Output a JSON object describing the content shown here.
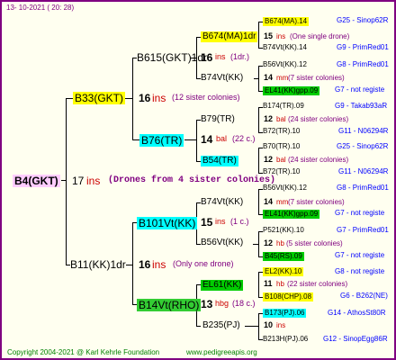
{
  "header": {
    "date": "13- 10-2021 ( 20: 28)"
  },
  "footer": {
    "copyright": "Copyright 2004-2021 @ Karl Kehrle Foundation",
    "website": "www.pedigreeapis.org"
  },
  "root": {
    "name": "B4(GKT)",
    "count": "17",
    "ins": "ins",
    "note": "(Drones from 4 sister colonies)"
  },
  "gen2": [
    {
      "name": "B33(GKT)",
      "count": "16",
      "ins": "ins",
      "note": "(12 sister colonies)"
    },
    {
      "name": "B11(KK)1dr",
      "count": "16",
      "ins": "ins",
      "note": "(Only one drone)"
    }
  ],
  "gen3": [
    {
      "name": "B615(GKT)1dr",
      "count": "16",
      "ins": "ins",
      "note": "(1dr.)"
    },
    {
      "name": "B76(TR)",
      "count": "14",
      "ins": "bal",
      "note": "(22 c.)"
    },
    {
      "name": "B101Vt(KK)",
      "count": "15",
      "ins": "ins",
      "note": "(1 c.)"
    },
    {
      "name": "B14Vt(RHO)",
      "count": "13",
      "ins": "hbg",
      "note": "(18 c.)"
    }
  ],
  "gen4": [
    {
      "name": "B674(MA)1dr",
      "count": "15",
      "ins": "ins",
      "note": "(One single drone)"
    },
    {
      "name": "B74Vt(KK)"
    },
    {
      "name": "B79(TR)",
      "count": "12",
      "ins": "bal",
      "note": "(24 sister colonies)"
    },
    {
      "name": "B54(TR)",
      "count": "12",
      "ins": "bal",
      "note": "(24 sister colonies)"
    },
    {
      "name": "B74Vt(KK)",
      "count": "14",
      "ins": "mm",
      "note": "(7 sister colonies)"
    },
    {
      "name": "B56Vt(KK)"
    },
    {
      "name": "EL61(KK)",
      "count": "11",
      "ins": "hb",
      "note": "(22 sister colonies)"
    },
    {
      "name": "B235(PJ)",
      "count": "10",
      "ins": "ins",
      "note": ""
    }
  ],
  "gen5": [
    {
      "name": "B674(MA).14",
      "code": "G25 - Sinop62R"
    },
    {
      "name": "B74Vt(KK).14",
      "code": "G9 - PrimRed01"
    },
    {
      "name": "B56Vt(KK).12",
      "code": "G8 - PrimRed01"
    },
    {
      "name": "EL41(KK)gpp.09",
      "code": "G7 - not registe"
    },
    {
      "name": "B174(TR).09",
      "code": "G9 - Takab93aR"
    },
    {
      "name": "B72(TR).10",
      "code": "G11 - N06294R"
    },
    {
      "name": "B70(TR).10",
      "code": "G25 - Sinop62R"
    },
    {
      "name": "B72(TR).10",
      "code": "G11 - N06294R"
    },
    {
      "name": "B56Vt(KK).12",
      "code": "G8 - PrimRed01"
    },
    {
      "name": "EL41(KK)gpp.09",
      "code": "G7 - not registe"
    },
    {
      "name": "P521(KK).10",
      "code": "G7 - PrimRed01"
    },
    {
      "name": "B45(RS).09",
      "code": "G7 - not registe"
    },
    {
      "name": "EL2(KK).10",
      "code": "G8 - not registe"
    },
    {
      "name": "B108(CHP).08",
      "code": "G6 - B262(NE)"
    },
    {
      "name": "B173(PJ).06",
      "code": "G14 - AthosSt80R"
    },
    {
      "name": "B213H(PJ).06",
      "code": "G12 - SinopEgg86R"
    }
  ]
}
